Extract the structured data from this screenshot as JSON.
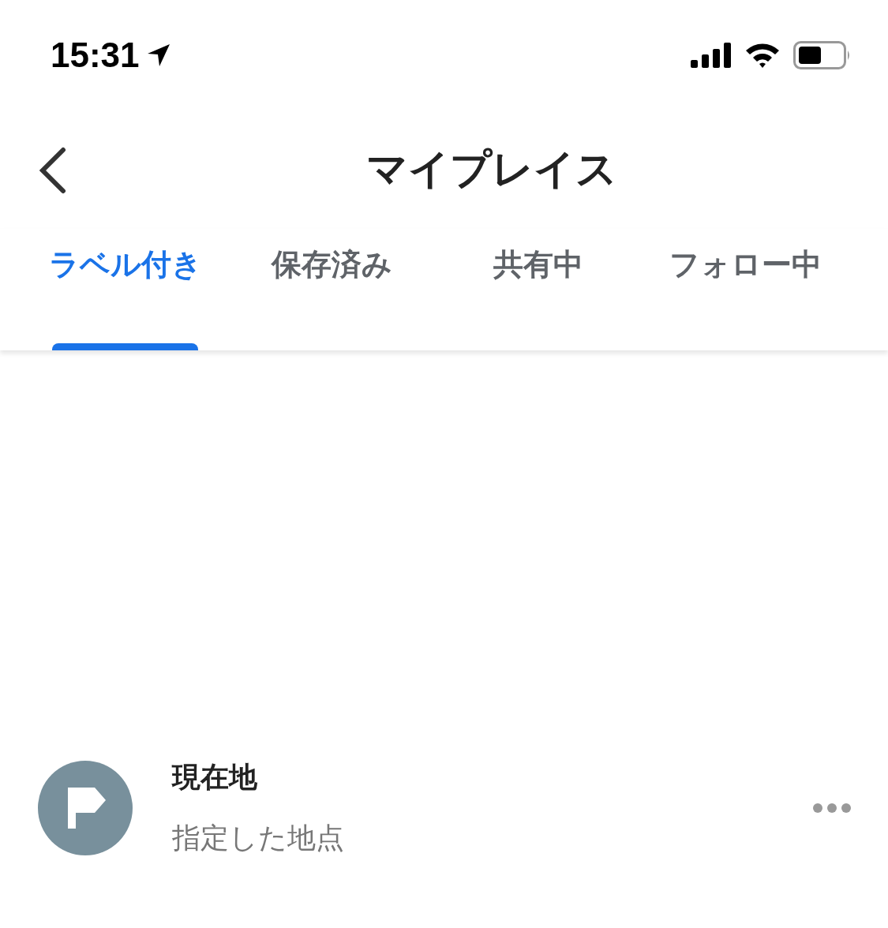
{
  "status_bar": {
    "time": "15:31"
  },
  "header": {
    "title": "マイプレイス"
  },
  "tabs": [
    {
      "label": "ラベル付き",
      "selected": true
    },
    {
      "label": "保存済み",
      "selected": false
    },
    {
      "label": "共有中",
      "selected": false
    },
    {
      "label": "フォロー中",
      "selected": false
    }
  ],
  "places": [
    {
      "name": "現在地",
      "subtitle": "指定した地点"
    }
  ]
}
